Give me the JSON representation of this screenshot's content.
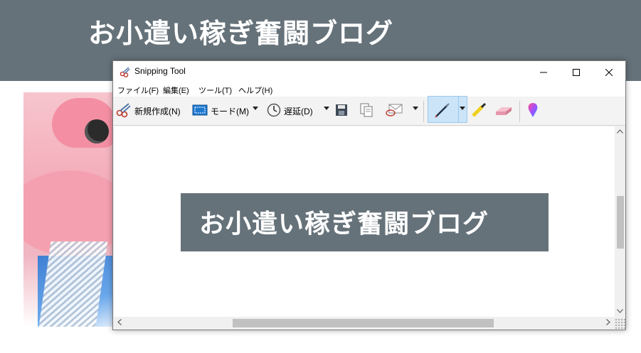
{
  "blog": {
    "title": "お小遣い稼ぎ奮闘ブログ",
    "header_color": "#66727a"
  },
  "window": {
    "title": "Snipping Tool",
    "app_icon": "scissors-icon",
    "controls": {
      "minimize": "minimize-icon",
      "maximize": "maximize-icon",
      "close": "close-icon"
    }
  },
  "menu": {
    "items": [
      "ファイル(F)",
      "編集(E)",
      "ツール(T)",
      "ヘルプ(H)"
    ]
  },
  "toolbar": {
    "new_label": "新規作成(N)",
    "mode_label": "モード(M)",
    "delay_label": "遅延(D)",
    "icons": [
      "scissors-icon",
      "mode-rect-icon",
      "clock-icon",
      "save-icon",
      "copy-icon",
      "send-mail-icon",
      "pen-icon",
      "highlighter-icon",
      "eraser-icon",
      "paint3d-icon"
    ],
    "active_tool": "pen",
    "accent": "#cce4f7"
  },
  "canvas": {
    "snip_text": "お小遣い稼ぎ奮闘ブログ"
  }
}
